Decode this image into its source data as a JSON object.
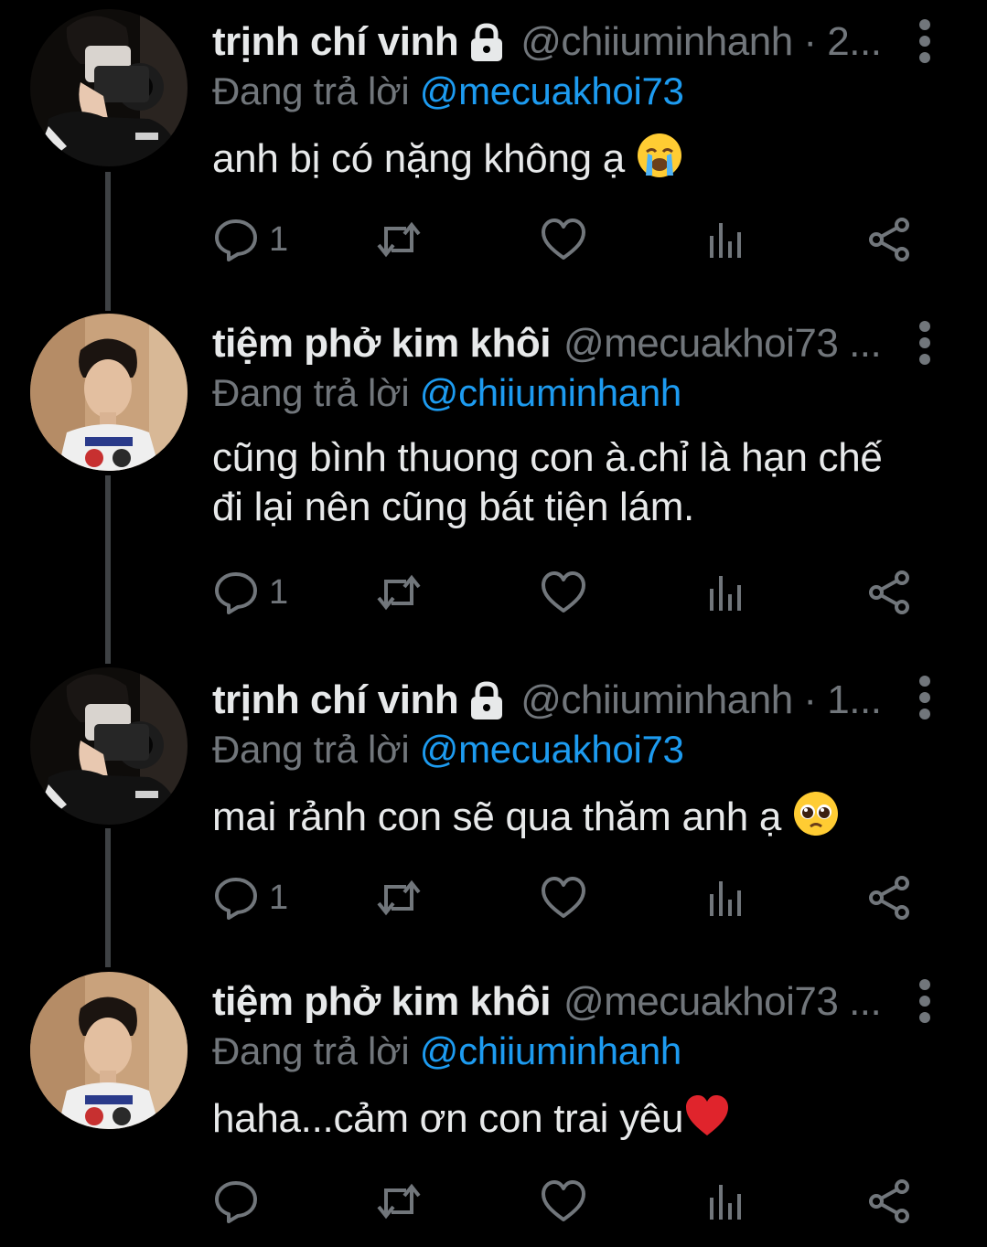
{
  "theme": {
    "background": "#000000",
    "text": "#e7e9ea",
    "muted": "#71767b",
    "link": "#1d9bf0",
    "thread_line": "#3e4144"
  },
  "tweets": [
    {
      "display_name": "trịnh chí vinh",
      "locked": true,
      "handle": "@chiiuminhanh · 2...",
      "reply_prefix": "Đang trả lời",
      "reply_to": "@mecuakhoi73",
      "lines": [
        "anh bị có nặng không ạ"
      ],
      "emoji": "crying-face",
      "reply_count": "1"
    },
    {
      "display_name": "tiệm phở kim khôi",
      "locked": false,
      "handle": "@mecuakhoi73 ...",
      "reply_prefix": "Đang trả lời",
      "reply_to": "@chiiuminhanh",
      "lines": [
        "cũng bình thuong con à.chỉ là hạn chế",
        "đi lại nên cũng bát tiện lám."
      ],
      "emoji": "",
      "reply_count": "1"
    },
    {
      "display_name": "trịnh chí vinh",
      "locked": true,
      "handle": "@chiiuminhanh · 1...",
      "reply_prefix": "Đang trả lời",
      "reply_to": "@mecuakhoi73",
      "lines": [
        "mai rảnh con sẽ qua thăm anh ạ"
      ],
      "emoji": "pleading-face",
      "reply_count": "1"
    },
    {
      "display_name": "tiệm phở kim khôi",
      "locked": false,
      "handle": "@mecuakhoi73 ...",
      "reply_prefix": "Đang trả lời",
      "reply_to": "@chiiuminhanh",
      "lines": [
        "haha...cảm ơn con trai yêu"
      ],
      "emoji": "red-heart",
      "reply_count": ""
    }
  ]
}
